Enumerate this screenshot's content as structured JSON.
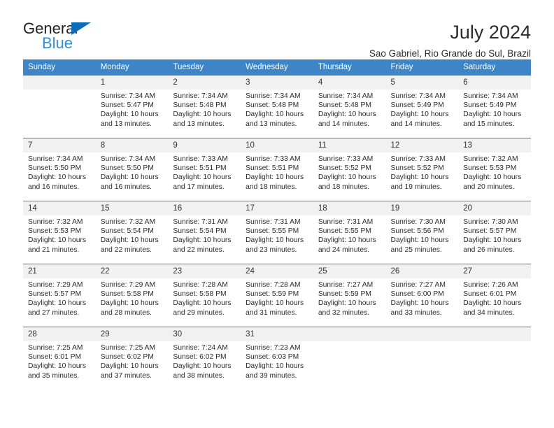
{
  "logo": {
    "word_one": "General",
    "word_two": "Blue",
    "triangle_color": "#0b6cb7",
    "blue_text_color": "#2f8fd6"
  },
  "header": {
    "title": "July 2024",
    "subtitle": "Sao Gabriel, Rio Grande do Sul, Brazil",
    "accent_color": "#3d85c6"
  },
  "calendar": {
    "weekday_headers": [
      "Sunday",
      "Monday",
      "Tuesday",
      "Wednesday",
      "Thursday",
      "Friday",
      "Saturday"
    ],
    "weeks": [
      [
        {
          "day": "",
          "blank": true,
          "sunrise": "",
          "sunset": "",
          "daylight_line1": "",
          "daylight_line2": ""
        },
        {
          "day": "1",
          "blank": false,
          "sunrise": "Sunrise: 7:34 AM",
          "sunset": "Sunset: 5:47 PM",
          "daylight_line1": "Daylight: 10 hours",
          "daylight_line2": "and 13 minutes."
        },
        {
          "day": "2",
          "blank": false,
          "sunrise": "Sunrise: 7:34 AM",
          "sunset": "Sunset: 5:48 PM",
          "daylight_line1": "Daylight: 10 hours",
          "daylight_line2": "and 13 minutes."
        },
        {
          "day": "3",
          "blank": false,
          "sunrise": "Sunrise: 7:34 AM",
          "sunset": "Sunset: 5:48 PM",
          "daylight_line1": "Daylight: 10 hours",
          "daylight_line2": "and 13 minutes."
        },
        {
          "day": "4",
          "blank": false,
          "sunrise": "Sunrise: 7:34 AM",
          "sunset": "Sunset: 5:48 PM",
          "daylight_line1": "Daylight: 10 hours",
          "daylight_line2": "and 14 minutes."
        },
        {
          "day": "5",
          "blank": false,
          "sunrise": "Sunrise: 7:34 AM",
          "sunset": "Sunset: 5:49 PM",
          "daylight_line1": "Daylight: 10 hours",
          "daylight_line2": "and 14 minutes."
        },
        {
          "day": "6",
          "blank": false,
          "sunrise": "Sunrise: 7:34 AM",
          "sunset": "Sunset: 5:49 PM",
          "daylight_line1": "Daylight: 10 hours",
          "daylight_line2": "and 15 minutes."
        }
      ],
      [
        {
          "day": "7",
          "blank": false,
          "sunrise": "Sunrise: 7:34 AM",
          "sunset": "Sunset: 5:50 PM",
          "daylight_line1": "Daylight: 10 hours",
          "daylight_line2": "and 16 minutes."
        },
        {
          "day": "8",
          "blank": false,
          "sunrise": "Sunrise: 7:34 AM",
          "sunset": "Sunset: 5:50 PM",
          "daylight_line1": "Daylight: 10 hours",
          "daylight_line2": "and 16 minutes."
        },
        {
          "day": "9",
          "blank": false,
          "sunrise": "Sunrise: 7:33 AM",
          "sunset": "Sunset: 5:51 PM",
          "daylight_line1": "Daylight: 10 hours",
          "daylight_line2": "and 17 minutes."
        },
        {
          "day": "10",
          "blank": false,
          "sunrise": "Sunrise: 7:33 AM",
          "sunset": "Sunset: 5:51 PM",
          "daylight_line1": "Daylight: 10 hours",
          "daylight_line2": "and 18 minutes."
        },
        {
          "day": "11",
          "blank": false,
          "sunrise": "Sunrise: 7:33 AM",
          "sunset": "Sunset: 5:52 PM",
          "daylight_line1": "Daylight: 10 hours",
          "daylight_line2": "and 18 minutes."
        },
        {
          "day": "12",
          "blank": false,
          "sunrise": "Sunrise: 7:33 AM",
          "sunset": "Sunset: 5:52 PM",
          "daylight_line1": "Daylight: 10 hours",
          "daylight_line2": "and 19 minutes."
        },
        {
          "day": "13",
          "blank": false,
          "sunrise": "Sunrise: 7:32 AM",
          "sunset": "Sunset: 5:53 PM",
          "daylight_line1": "Daylight: 10 hours",
          "daylight_line2": "and 20 minutes."
        }
      ],
      [
        {
          "day": "14",
          "blank": false,
          "sunrise": "Sunrise: 7:32 AM",
          "sunset": "Sunset: 5:53 PM",
          "daylight_line1": "Daylight: 10 hours",
          "daylight_line2": "and 21 minutes."
        },
        {
          "day": "15",
          "blank": false,
          "sunrise": "Sunrise: 7:32 AM",
          "sunset": "Sunset: 5:54 PM",
          "daylight_line1": "Daylight: 10 hours",
          "daylight_line2": "and 22 minutes."
        },
        {
          "day": "16",
          "blank": false,
          "sunrise": "Sunrise: 7:31 AM",
          "sunset": "Sunset: 5:54 PM",
          "daylight_line1": "Daylight: 10 hours",
          "daylight_line2": "and 22 minutes."
        },
        {
          "day": "17",
          "blank": false,
          "sunrise": "Sunrise: 7:31 AM",
          "sunset": "Sunset: 5:55 PM",
          "daylight_line1": "Daylight: 10 hours",
          "daylight_line2": "and 23 minutes."
        },
        {
          "day": "18",
          "blank": false,
          "sunrise": "Sunrise: 7:31 AM",
          "sunset": "Sunset: 5:55 PM",
          "daylight_line1": "Daylight: 10 hours",
          "daylight_line2": "and 24 minutes."
        },
        {
          "day": "19",
          "blank": false,
          "sunrise": "Sunrise: 7:30 AM",
          "sunset": "Sunset: 5:56 PM",
          "daylight_line1": "Daylight: 10 hours",
          "daylight_line2": "and 25 minutes."
        },
        {
          "day": "20",
          "blank": false,
          "sunrise": "Sunrise: 7:30 AM",
          "sunset": "Sunset: 5:57 PM",
          "daylight_line1": "Daylight: 10 hours",
          "daylight_line2": "and 26 minutes."
        }
      ],
      [
        {
          "day": "21",
          "blank": false,
          "sunrise": "Sunrise: 7:29 AM",
          "sunset": "Sunset: 5:57 PM",
          "daylight_line1": "Daylight: 10 hours",
          "daylight_line2": "and 27 minutes."
        },
        {
          "day": "22",
          "blank": false,
          "sunrise": "Sunrise: 7:29 AM",
          "sunset": "Sunset: 5:58 PM",
          "daylight_line1": "Daylight: 10 hours",
          "daylight_line2": "and 28 minutes."
        },
        {
          "day": "23",
          "blank": false,
          "sunrise": "Sunrise: 7:28 AM",
          "sunset": "Sunset: 5:58 PM",
          "daylight_line1": "Daylight: 10 hours",
          "daylight_line2": "and 29 minutes."
        },
        {
          "day": "24",
          "blank": false,
          "sunrise": "Sunrise: 7:28 AM",
          "sunset": "Sunset: 5:59 PM",
          "daylight_line1": "Daylight: 10 hours",
          "daylight_line2": "and 31 minutes."
        },
        {
          "day": "25",
          "blank": false,
          "sunrise": "Sunrise: 7:27 AM",
          "sunset": "Sunset: 5:59 PM",
          "daylight_line1": "Daylight: 10 hours",
          "daylight_line2": "and 32 minutes."
        },
        {
          "day": "26",
          "blank": false,
          "sunrise": "Sunrise: 7:27 AM",
          "sunset": "Sunset: 6:00 PM",
          "daylight_line1": "Daylight: 10 hours",
          "daylight_line2": "and 33 minutes."
        },
        {
          "day": "27",
          "blank": false,
          "sunrise": "Sunrise: 7:26 AM",
          "sunset": "Sunset: 6:01 PM",
          "daylight_line1": "Daylight: 10 hours",
          "daylight_line2": "and 34 minutes."
        }
      ],
      [
        {
          "day": "28",
          "blank": false,
          "sunrise": "Sunrise: 7:25 AM",
          "sunset": "Sunset: 6:01 PM",
          "daylight_line1": "Daylight: 10 hours",
          "daylight_line2": "and 35 minutes."
        },
        {
          "day": "29",
          "blank": false,
          "sunrise": "Sunrise: 7:25 AM",
          "sunset": "Sunset: 6:02 PM",
          "daylight_line1": "Daylight: 10 hours",
          "daylight_line2": "and 37 minutes."
        },
        {
          "day": "30",
          "blank": false,
          "sunrise": "Sunrise: 7:24 AM",
          "sunset": "Sunset: 6:02 PM",
          "daylight_line1": "Daylight: 10 hours",
          "daylight_line2": "and 38 minutes."
        },
        {
          "day": "31",
          "blank": false,
          "sunrise": "Sunrise: 7:23 AM",
          "sunset": "Sunset: 6:03 PM",
          "daylight_line1": "Daylight: 10 hours",
          "daylight_line2": "and 39 minutes."
        },
        {
          "day": "",
          "blank": true,
          "sunrise": "",
          "sunset": "",
          "daylight_line1": "",
          "daylight_line2": ""
        },
        {
          "day": "",
          "blank": true,
          "sunrise": "",
          "sunset": "",
          "daylight_line1": "",
          "daylight_line2": ""
        },
        {
          "day": "",
          "blank": true,
          "sunrise": "",
          "sunset": "",
          "daylight_line1": "",
          "daylight_line2": ""
        }
      ]
    ]
  }
}
